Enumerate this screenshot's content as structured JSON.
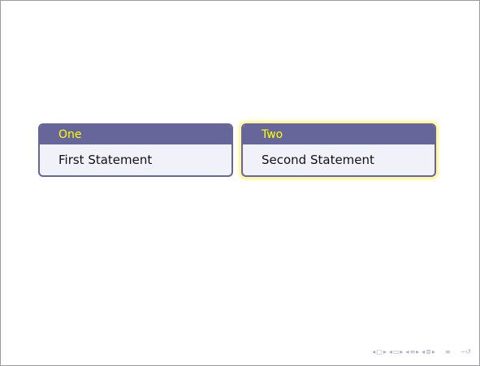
{
  "blocks": [
    {
      "title": "One",
      "body": "First Statement"
    },
    {
      "title": "Two",
      "body": "Second Statement"
    }
  ],
  "navigation": {
    "icons": [
      "slide-nav-icon",
      "frame-nav-icon",
      "subsection-nav-icon",
      "section-nav-icon",
      "align-icon",
      "search-icon"
    ],
    "glyphs": {
      "prev": "◂",
      "next": "▸",
      "slide": "□",
      "frame": "▭",
      "subsection": "≡",
      "section": "≣",
      "align": "≡",
      "search": "∽↺"
    }
  },
  "colors": {
    "block_border": "#66669a",
    "title_bg": "#66669a",
    "title_text": "#ffff00",
    "body_bg": "#f1f1fa",
    "highlight": "#fff6a8"
  }
}
